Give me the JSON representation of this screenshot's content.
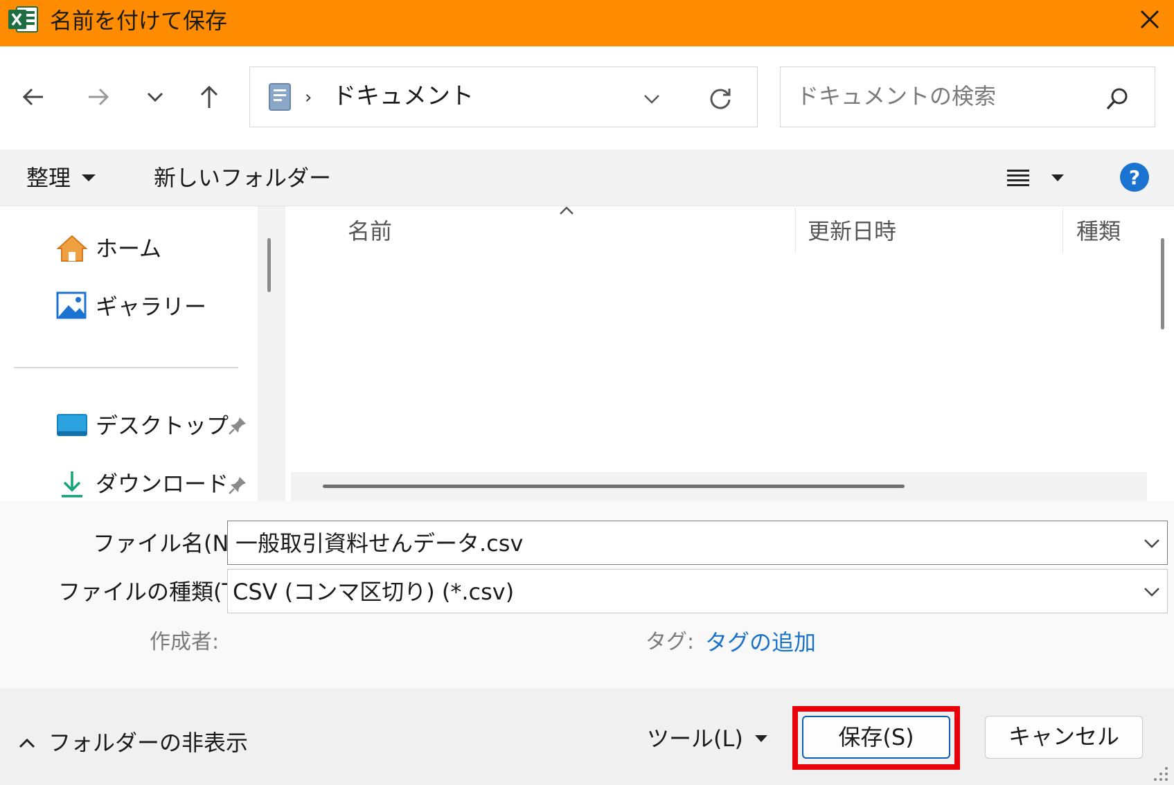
{
  "window": {
    "title": "名前を付けて保存",
    "app_icon": "excel-icon",
    "accent_color": "#ff8c00"
  },
  "address": {
    "location": "ドキュメント",
    "search_placeholder": "ドキュメントの検索"
  },
  "toolbar": {
    "organize_label": "整理",
    "new_folder_label": "新しいフォルダー"
  },
  "sidebar": {
    "items": [
      {
        "label": "ホーム",
        "icon": "home-icon",
        "pinned": false
      },
      {
        "label": "ギャラリー",
        "icon": "gallery-icon",
        "pinned": false
      },
      {
        "label": "デスクトップ",
        "icon": "desktop-icon",
        "pinned": true
      },
      {
        "label": "ダウンロード",
        "icon": "download-icon",
        "pinned": true
      }
    ]
  },
  "file_list": {
    "columns": [
      "名前",
      "更新日時",
      "種類"
    ]
  },
  "form": {
    "filename_label": "ファイル名(N):",
    "filename_value": "一般取引資料せんデータ.csv",
    "filetype_label": "ファイルの種類(T):",
    "filetype_value": "CSV (コンマ区切り) (*.csv)",
    "author_label": "作成者:",
    "tag_label": "タグ:",
    "tag_link": "タグの追加"
  },
  "footer": {
    "hide_folders_label": "フォルダーの非表示",
    "tools_label": "ツール(L)",
    "save_label": "保存(S)",
    "cancel_label": "キャンセル",
    "highlight_color": "#e8000b"
  }
}
